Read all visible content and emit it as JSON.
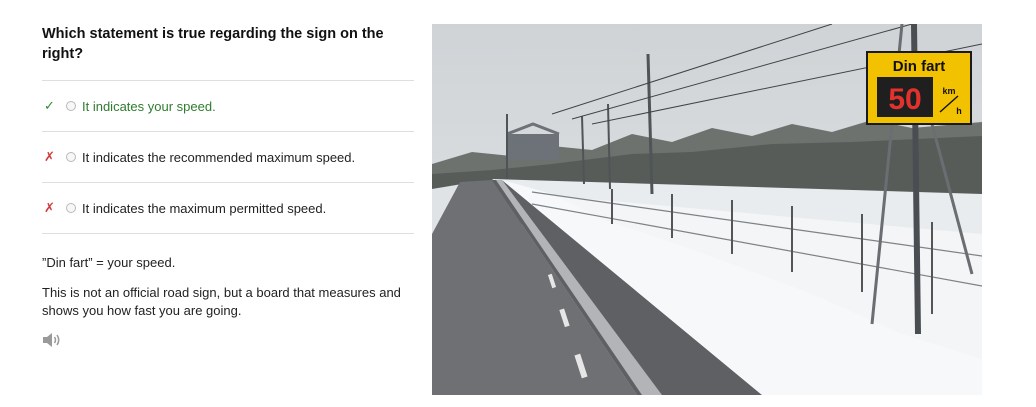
{
  "question": "Which statement is true regarding the sign on the right?",
  "answers": [
    {
      "label": "It indicates your speed.",
      "status": "correct",
      "mark": "✓"
    },
    {
      "label": "It indicates the recommended maximum speed.",
      "status": "wrong",
      "mark": "✗"
    },
    {
      "label": "It indicates the maximum permitted speed.",
      "status": "wrong",
      "mark": "✗"
    }
  ],
  "explanation": {
    "line1": "”Din fart” = your speed.",
    "line2": "This is not an official road sign, but a board that measures and shows you how fast you are going."
  },
  "audio_icon": "speaker-icon",
  "photo": {
    "sign_title": "Din fart",
    "sign_value": "50",
    "sign_unit_top": "km",
    "sign_unit_bottom": "h"
  },
  "colors": {
    "correct": "#2e7d2e",
    "wrong": "#d03a3a",
    "sign_yellow": "#f2c200"
  }
}
